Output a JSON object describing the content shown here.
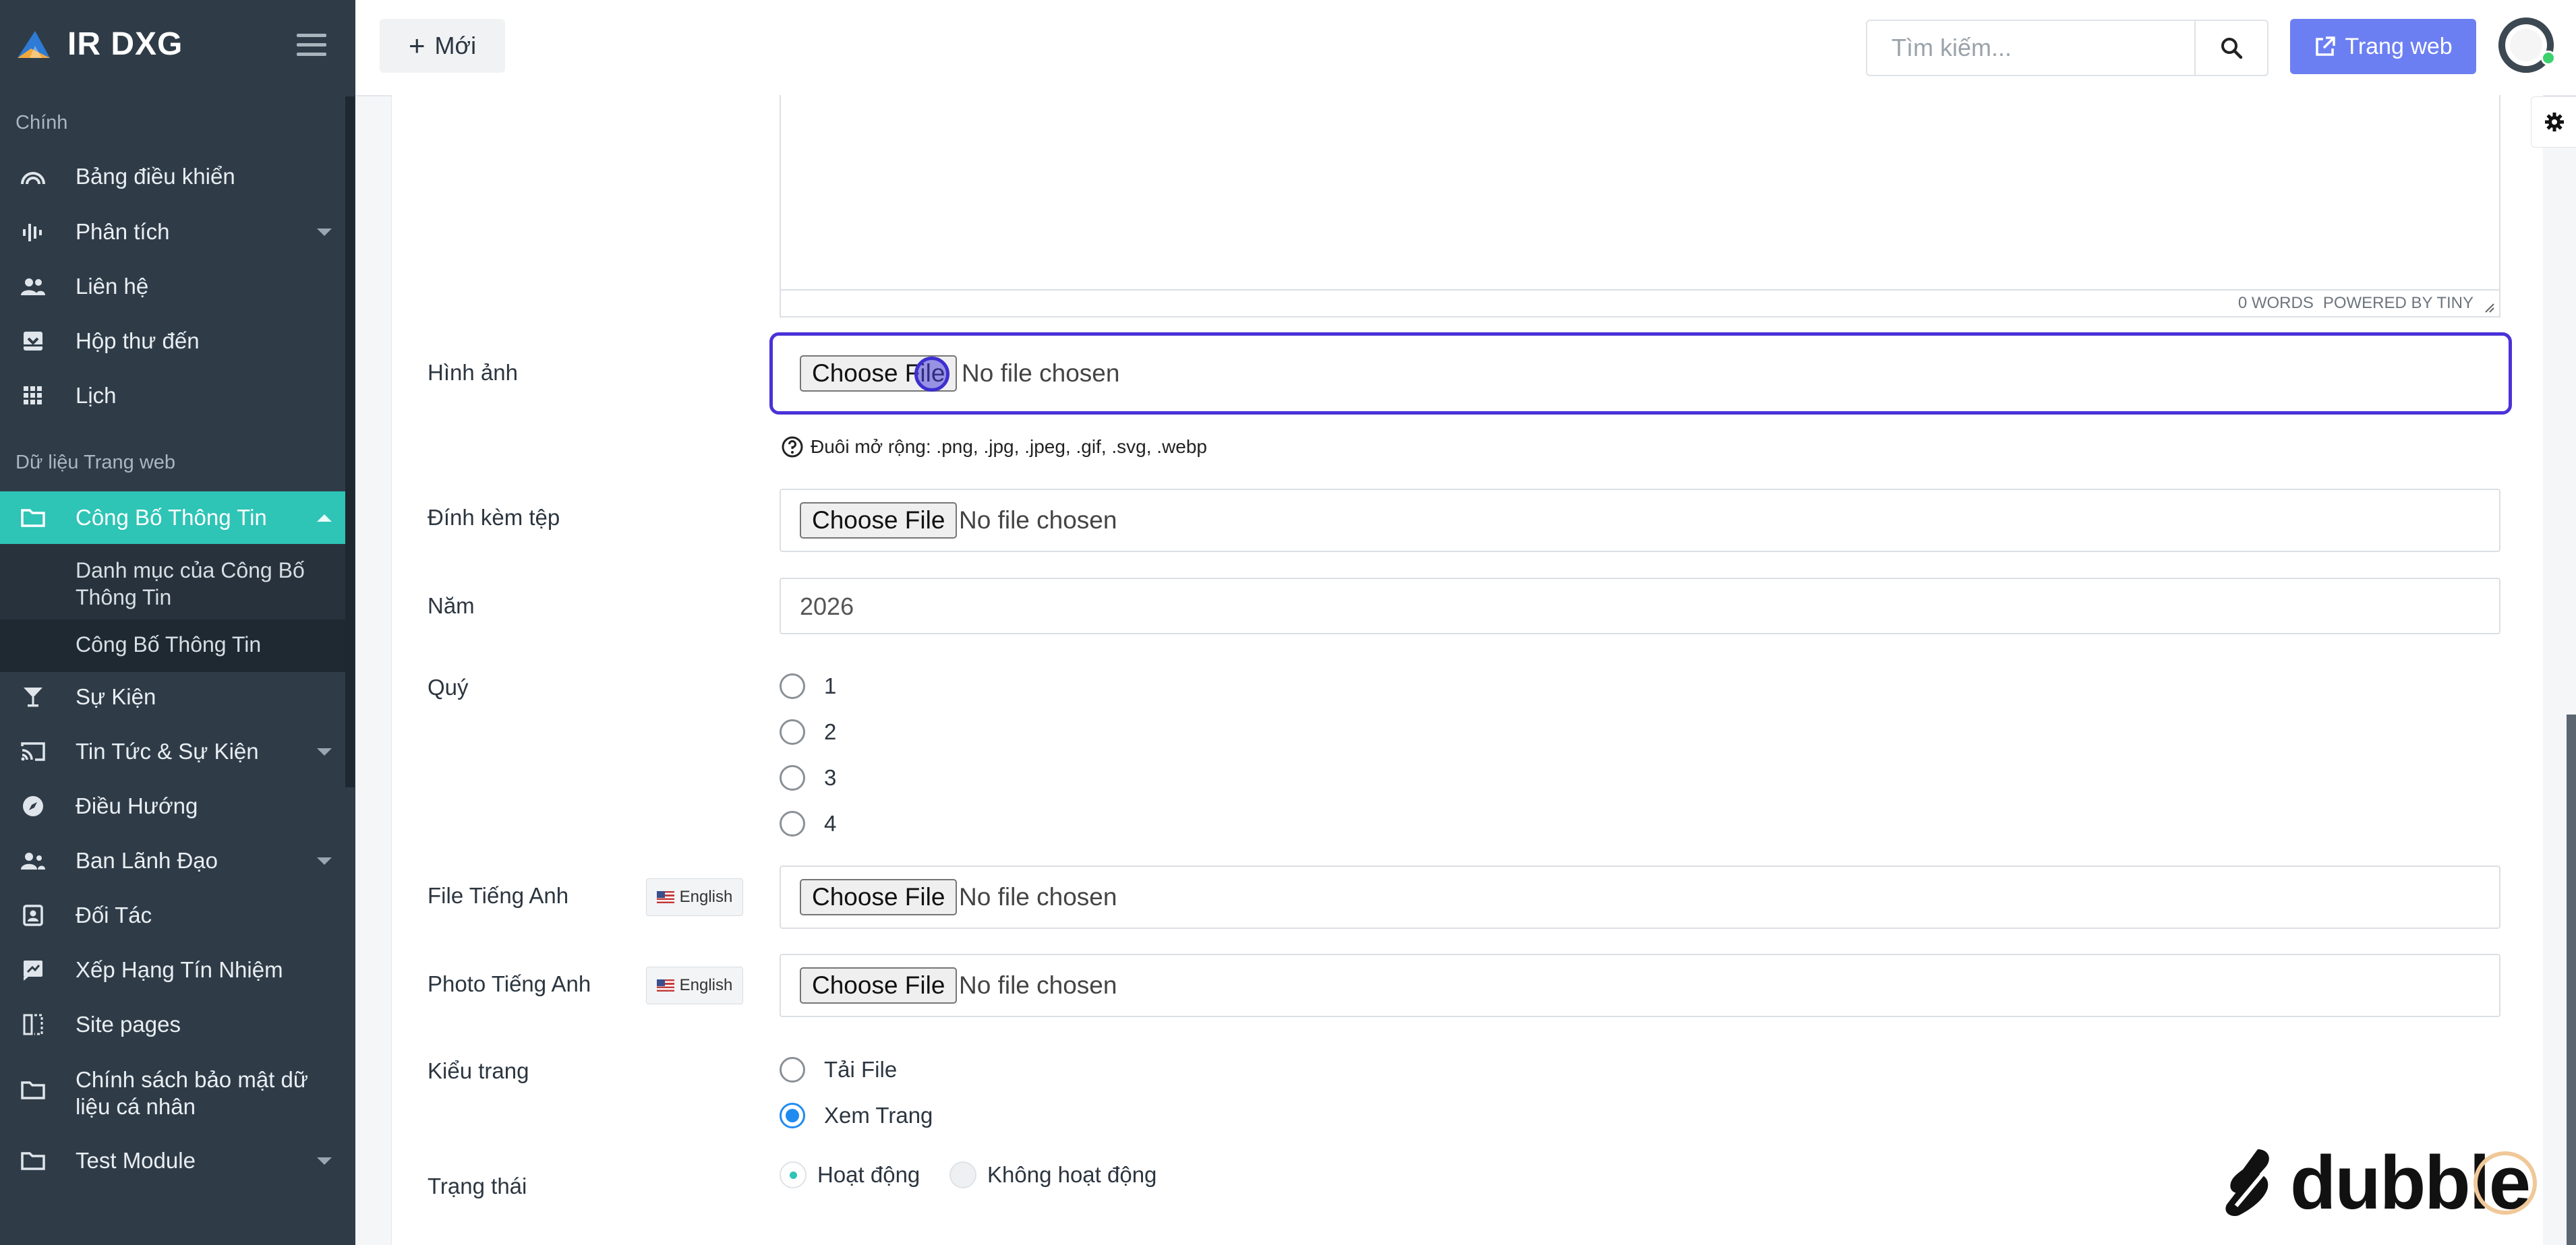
{
  "brand": {
    "name": "IR DXG"
  },
  "sidebar": {
    "section_main": "Chính",
    "section_data": "Dữ liệu Trang web",
    "items": [
      {
        "label": "Bảng điều khiển",
        "icon": "gauge-icon"
      },
      {
        "label": "Phân tích",
        "icon": "analytics-icon"
      },
      {
        "label": "Liên hệ",
        "icon": "people-icon"
      },
      {
        "label": "Hộp thư đến",
        "icon": "inbox-icon"
      },
      {
        "label": "Lịch",
        "icon": "grid-icon"
      },
      {
        "label": "Công Bố Thông Tin",
        "icon": "folder-icon"
      },
      {
        "label": "Sự Kiện",
        "icon": "cocktail-icon"
      },
      {
        "label": "Tin Tức & Sự Kiện",
        "icon": "cast-icon"
      },
      {
        "label": "Điều Hướng",
        "icon": "compass-icon"
      },
      {
        "label": "Ban Lãnh Đạo",
        "icon": "team-icon"
      },
      {
        "label": "Đối Tác",
        "icon": "contact-card-icon"
      },
      {
        "label": "Xếp Hạng Tín Nhiệm",
        "icon": "rating-icon"
      },
      {
        "label": "Site pages",
        "icon": "pages-icon"
      },
      {
        "label": "Chính sách bảo mật dữ liệu cá nhân",
        "icon": "folder-icon"
      },
      {
        "label": "Test Module",
        "icon": "folder-icon"
      }
    ],
    "sub_items": [
      {
        "label": "Danh mục của Công Bố Thông Tin"
      },
      {
        "label": "Công Bố Thông Tin"
      }
    ]
  },
  "topbar": {
    "new_label": "Mới",
    "search_placeholder": "Tìm kiếm...",
    "website_label": "Trang web"
  },
  "editor": {
    "status_words": "0 WORDS",
    "status_powered": "POWERED BY TINY"
  },
  "form": {
    "image_label": "Hình ảnh",
    "choose_file": "Choose File",
    "no_file": "No file chosen",
    "extensions_hint": "Đuôi mở rộng: .png, .jpg, .jpeg, .gif, .svg, .webp",
    "attachment_label": "Đính kèm tệp",
    "year_label": "Năm",
    "year_value": "2026",
    "quarter_label": "Quý",
    "quarters": [
      "1",
      "2",
      "3",
      "4"
    ],
    "file_en_label": "File Tiếng Anh",
    "photo_en_label": "Photo Tiếng Anh",
    "lang_tag": "English",
    "page_type_label": "Kiểu trang",
    "page_types": [
      "Tải File",
      "Xem Trang"
    ],
    "page_type_selected": "Xem Trang",
    "status_label": "Trạng thái",
    "status_options": [
      "Hoạt động",
      "Không hoạt động"
    ],
    "status_selected": "Hoạt động"
  },
  "watermark": {
    "text": "dubble"
  },
  "colors": {
    "sidebar_bg": "#2f3c48",
    "active_teal": "#2ec4b6",
    "web_button": "#6c7ff2",
    "focus_border": "#4a32d8",
    "radio_checked": "#1f8bf0"
  }
}
